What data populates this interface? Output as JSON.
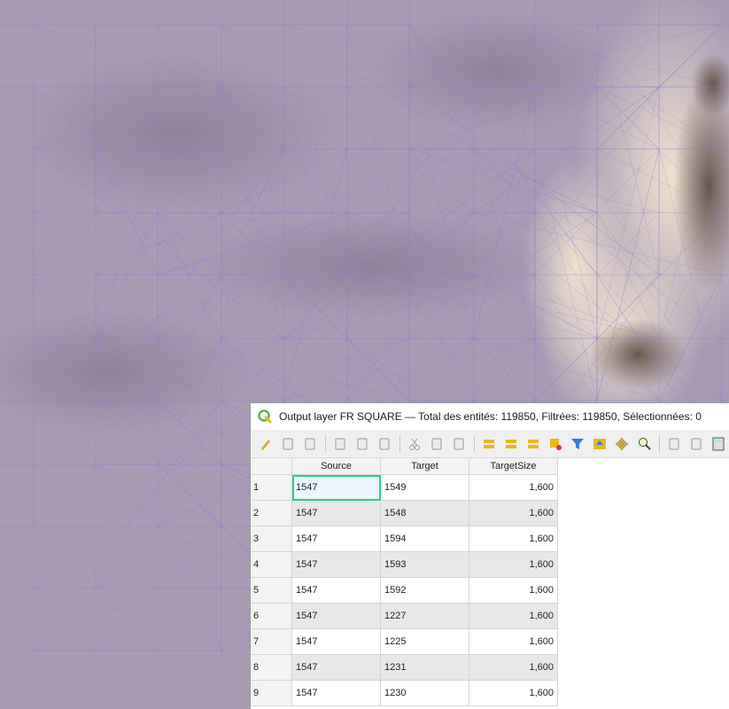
{
  "window": {
    "title": "Output layer FR SQUARE — Total des entités: 119850, Filtrées: 119850, Sélectionnées: 0"
  },
  "toolbar": {
    "buttons": [
      "toggle-editing-icon",
      "multi-edit-icon",
      "save-edits-icon",
      "reload-icon",
      "add-feature-icon",
      "delete-feature-icon",
      "cut-icon",
      "copy-icon",
      "paste-icon",
      "select-by-expression-icon",
      "select-all-icon",
      "invert-selection-icon",
      "deselect-all-icon",
      "filter-select-icon",
      "move-selection-top-icon",
      "pan-map-icon",
      "zoom-map-icon",
      "new-field-icon",
      "delete-field-icon",
      "field-calculator-icon",
      "conditional-formatting-icon"
    ]
  },
  "table": {
    "columns": [
      "Source",
      "Target",
      "TargetSize"
    ],
    "rows": [
      {
        "num": "1",
        "source": "1547",
        "target": "1549",
        "size": "1,600"
      },
      {
        "num": "2",
        "source": "1547",
        "target": "1548",
        "size": "1,600"
      },
      {
        "num": "3",
        "source": "1547",
        "target": "1594",
        "size": "1,600"
      },
      {
        "num": "4",
        "source": "1547",
        "target": "1593",
        "size": "1,600"
      },
      {
        "num": "5",
        "source": "1547",
        "target": "1592",
        "size": "1,600"
      },
      {
        "num": "6",
        "source": "1547",
        "target": "1227",
        "size": "1,600"
      },
      {
        "num": "7",
        "source": "1547",
        "target": "1225",
        "size": "1,600"
      },
      {
        "num": "8",
        "source": "1547",
        "target": "1231",
        "size": "1,600"
      },
      {
        "num": "9",
        "source": "1547",
        "target": "1230",
        "size": "1,600"
      }
    ]
  },
  "colors": {
    "map_base": "#a99ab4",
    "lines": "#8e7fd0",
    "terrain_light": "#e9dcc4",
    "terrain_dark": "#4a3f3a",
    "selection_outline": "#2fcc8a"
  }
}
